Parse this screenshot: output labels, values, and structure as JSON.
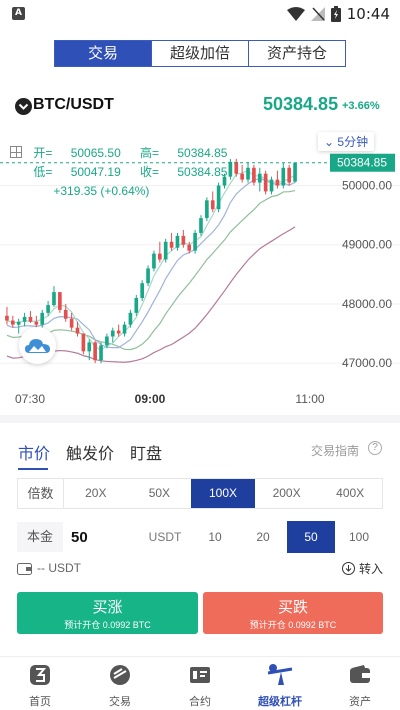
{
  "status_bar": {
    "app_icon_letter": "A",
    "time": "10:44"
  },
  "top_tabs": [
    {
      "label": "交易",
      "active": true
    },
    {
      "label": "超级加倍",
      "active": false
    },
    {
      "label": "资产持仓",
      "active": false
    }
  ],
  "pair": {
    "name": "BTC/USDT",
    "price": "50384.85",
    "change": "+3.66%"
  },
  "chart": {
    "interval_label": "5分钟",
    "ohlc": {
      "open_label": "开=",
      "open": "50065.50",
      "high_label": "高=",
      "high": "50384.85",
      "low_label": "低=",
      "low": "50047.19",
      "close_label": "收=",
      "close": "50384.85",
      "change": "+319.35 (+0.64%)"
    }
  },
  "chart_data": {
    "type": "candlestick",
    "title": "",
    "x_ticks": [
      "07:30",
      "09:00",
      "11:00"
    ],
    "y_ticks": [
      "50000.00",
      "49000.00",
      "48000.00",
      "47000.00"
    ],
    "last_price_label": "50384.85",
    "ylim": [
      46800,
      50600
    ],
    "candles": [
      {
        "o": 47800,
        "h": 47950,
        "l": 47650,
        "c": 47720
      },
      {
        "o": 47720,
        "h": 47800,
        "l": 47600,
        "c": 47650
      },
      {
        "o": 47650,
        "h": 47750,
        "l": 47500,
        "c": 47700
      },
      {
        "o": 47700,
        "h": 47850,
        "l": 47620,
        "c": 47780
      },
      {
        "o": 47780,
        "h": 47880,
        "l": 47680,
        "c": 47700
      },
      {
        "o": 47700,
        "h": 47800,
        "l": 47600,
        "c": 47650
      },
      {
        "o": 47650,
        "h": 47900,
        "l": 47600,
        "c": 47850
      },
      {
        "o": 47850,
        "h": 48050,
        "l": 47800,
        "c": 47980
      },
      {
        "o": 47980,
        "h": 48300,
        "l": 47950,
        "c": 48200
      },
      {
        "o": 48200,
        "h": 48200,
        "l": 47850,
        "c": 47900
      },
      {
        "o": 47900,
        "h": 48000,
        "l": 47700,
        "c": 47750
      },
      {
        "o": 47750,
        "h": 47850,
        "l": 47550,
        "c": 47600
      },
      {
        "o": 47600,
        "h": 47700,
        "l": 47450,
        "c": 47500
      },
      {
        "o": 47500,
        "h": 47500,
        "l": 47150,
        "c": 47200
      },
      {
        "o": 47200,
        "h": 47400,
        "l": 47050,
        "c": 47350
      },
      {
        "o": 47350,
        "h": 47380,
        "l": 47000,
        "c": 47050
      },
      {
        "o": 47050,
        "h": 47350,
        "l": 47000,
        "c": 47300
      },
      {
        "o": 47300,
        "h": 47500,
        "l": 47250,
        "c": 47450
      },
      {
        "o": 47450,
        "h": 47600,
        "l": 47350,
        "c": 47550
      },
      {
        "o": 47550,
        "h": 47650,
        "l": 47450,
        "c": 47500
      },
      {
        "o": 47500,
        "h": 47700,
        "l": 47450,
        "c": 47650
      },
      {
        "o": 47650,
        "h": 47900,
        "l": 47600,
        "c": 47850
      },
      {
        "o": 47850,
        "h": 48150,
        "l": 47800,
        "c": 48100
      },
      {
        "o": 48100,
        "h": 48400,
        "l": 48050,
        "c": 48350
      },
      {
        "o": 48350,
        "h": 48650,
        "l": 48300,
        "c": 48600
      },
      {
        "o": 48600,
        "h": 48900,
        "l": 48550,
        "c": 48850
      },
      {
        "o": 48850,
        "h": 49050,
        "l": 48700,
        "c": 48750
      },
      {
        "o": 48750,
        "h": 49100,
        "l": 48700,
        "c": 49050
      },
      {
        "o": 49050,
        "h": 49200,
        "l": 48900,
        "c": 48950
      },
      {
        "o": 48950,
        "h": 49200,
        "l": 48900,
        "c": 49150
      },
      {
        "o": 49150,
        "h": 49250,
        "l": 48950,
        "c": 49000
      },
      {
        "o": 49000,
        "h": 49050,
        "l": 48850,
        "c": 48900
      },
      {
        "o": 48900,
        "h": 49250,
        "l": 48850,
        "c": 49200
      },
      {
        "o": 49200,
        "h": 49500,
        "l": 49150,
        "c": 49450
      },
      {
        "o": 49450,
        "h": 49800,
        "l": 49400,
        "c": 49750
      },
      {
        "o": 49750,
        "h": 49900,
        "l": 49550,
        "c": 49600
      },
      {
        "o": 49600,
        "h": 50050,
        "l": 49550,
        "c": 50000
      },
      {
        "o": 50000,
        "h": 50200,
        "l": 49950,
        "c": 50150
      },
      {
        "o": 50150,
        "h": 50450,
        "l": 50100,
        "c": 50400
      },
      {
        "o": 50400,
        "h": 50450,
        "l": 50150,
        "c": 50200
      },
      {
        "o": 50200,
        "h": 50350,
        "l": 50050,
        "c": 50100
      },
      {
        "o": 50100,
        "h": 50400,
        "l": 50050,
        "c": 50300
      },
      {
        "o": 50300,
        "h": 50350,
        "l": 50000,
        "c": 50050
      },
      {
        "o": 50050,
        "h": 50300,
        "l": 49900,
        "c": 50200
      },
      {
        "o": 50200,
        "h": 50250,
        "l": 49850,
        "c": 49900
      },
      {
        "o": 49900,
        "h": 50150,
        "l": 49850,
        "c": 50100
      },
      {
        "o": 50100,
        "h": 50250,
        "l": 49950,
        "c": 50000
      },
      {
        "o": 50000,
        "h": 50380,
        "l": 49950,
        "c": 50300
      },
      {
        "o": 50300,
        "h": 50350,
        "l": 50000,
        "c": 50050
      },
      {
        "o": 50065.5,
        "h": 50384.85,
        "l": 50047.19,
        "c": 50384.85
      }
    ],
    "colors": {
      "up": "#19a887",
      "down": "#e34f4f",
      "ma_fast": "#a8d8c8",
      "ma_mid": "#8fbf9a",
      "ma_slow": "#b47b9a",
      "ma_blue": "#9fb3d9"
    }
  },
  "order": {
    "tabs": [
      {
        "label": "市价",
        "active": true
      },
      {
        "label": "触发价",
        "active": false
      },
      {
        "label": "盯盘",
        "active": false
      }
    ],
    "guide_label": "交易指南",
    "guide_help": "?",
    "multiplier_label": "倍数",
    "multipliers": [
      {
        "label": "20X",
        "active": false
      },
      {
        "label": "50X",
        "active": false
      },
      {
        "label": "100X",
        "active": true
      },
      {
        "label": "200X",
        "active": false
      },
      {
        "label": "400X",
        "active": false
      }
    ],
    "principal_label": "本金",
    "principal_value": "50",
    "principal_unit": "USDT",
    "principal_options": [
      {
        "label": "10",
        "active": false
      },
      {
        "label": "20",
        "active": false
      },
      {
        "label": "50",
        "active": true
      },
      {
        "label": "100",
        "active": false
      }
    ],
    "balance": "-- USDT",
    "transfer_label": "转入",
    "buy_up": {
      "title": "买涨",
      "sub": "预计开仓 0.0992 BTC"
    },
    "buy_down": {
      "title": "买跌",
      "sub": "预计开仓 0.0992 BTC"
    }
  },
  "bottom_nav": [
    {
      "label": "首页",
      "icon": "home-icon",
      "active": false
    },
    {
      "label": "交易",
      "icon": "trade-icon",
      "active": false
    },
    {
      "label": "合约",
      "icon": "contract-icon",
      "active": false
    },
    {
      "label": "超级杠杆",
      "icon": "leverage-icon",
      "active": true
    },
    {
      "label": "资产",
      "icon": "wallet-icon",
      "active": false
    }
  ],
  "colors": {
    "accent": "#2f50b6",
    "up": "#17b488",
    "down": "#ef6b5a",
    "price_green": "#19a887"
  }
}
